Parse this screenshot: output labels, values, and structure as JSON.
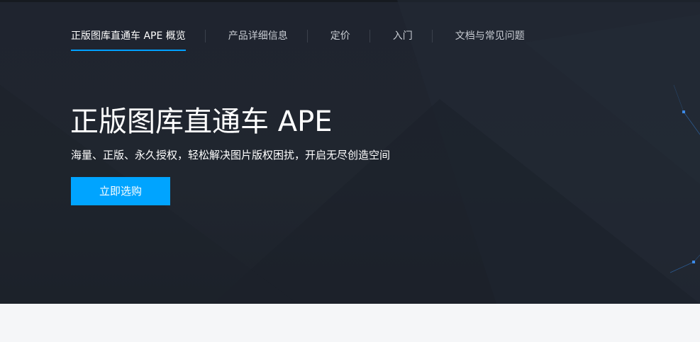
{
  "nav": {
    "items": [
      {
        "label": "正版图库直通车 APE 概览",
        "active": true
      },
      {
        "label": "产品详细信息",
        "active": false
      },
      {
        "label": "定价",
        "active": false
      },
      {
        "label": "入门",
        "active": false
      },
      {
        "label": "文档与常见问题",
        "active": false
      }
    ]
  },
  "hero": {
    "title": "正版图库直通车 APE",
    "subtitle": "海量、正版、永久授权，轻松解决图片版权困扰，开启无尽创造空间",
    "buy_label": "立即选购"
  },
  "colors": {
    "hero_bg": "#20262f",
    "accent": "#00a4ff",
    "nav_text": "#c8ccd3",
    "page_bg": "#f5f6f8"
  }
}
